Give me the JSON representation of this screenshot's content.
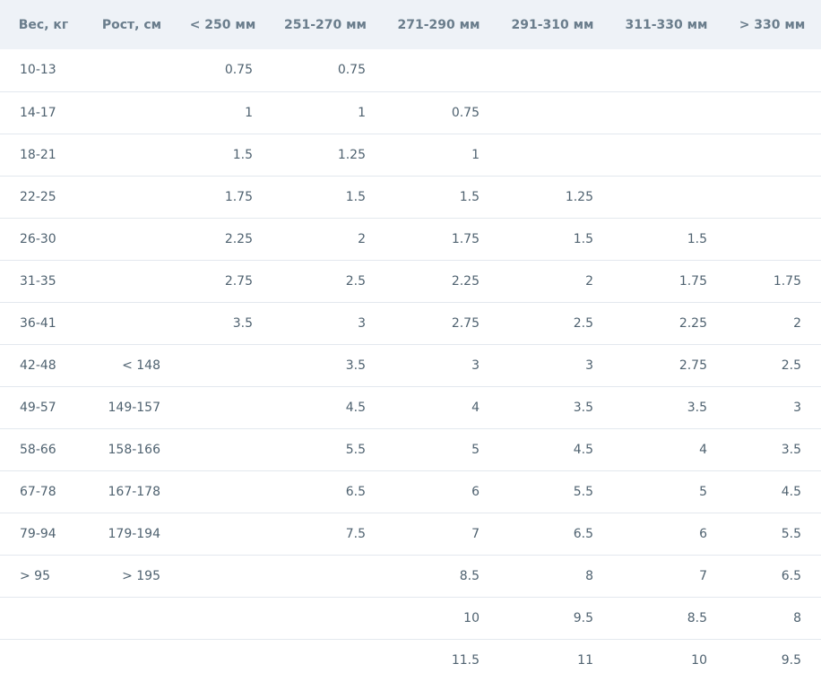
{
  "table": {
    "headers": [
      "Вес, кг",
      "Рост, см",
      "< 250 мм",
      "251-270 мм",
      "271-290 мм",
      "291-310 мм",
      "311-330 мм",
      "> 330 мм"
    ],
    "rows": [
      [
        "10-13",
        "",
        "0.75",
        "0.75",
        "",
        "",
        "",
        ""
      ],
      [
        "14-17",
        "",
        "1",
        "1",
        "0.75",
        "",
        "",
        ""
      ],
      [
        "18-21",
        "",
        "1.5",
        "1.25",
        "1",
        "",
        "",
        ""
      ],
      [
        "22-25",
        "",
        "1.75",
        "1.5",
        "1.5",
        "1.25",
        "",
        ""
      ],
      [
        "26-30",
        "",
        "2.25",
        "2",
        "1.75",
        "1.5",
        "1.5",
        ""
      ],
      [
        "31-35",
        "",
        "2.75",
        "2.5",
        "2.25",
        "2",
        "1.75",
        "1.75"
      ],
      [
        "36-41",
        "",
        "3.5",
        "3",
        "2.75",
        "2.5",
        "2.25",
        "2"
      ],
      [
        "42-48",
        "< 148",
        "",
        "3.5",
        "3",
        "3",
        "2.75",
        "2.5"
      ],
      [
        "49-57",
        "149-157",
        "",
        "4.5",
        "4",
        "3.5",
        "3.5",
        "3"
      ],
      [
        "58-66",
        "158-166",
        "",
        "5.5",
        "5",
        "4.5",
        "4",
        "3.5"
      ],
      [
        "67-78",
        "167-178",
        "",
        "6.5",
        "6",
        "5.5",
        "5",
        "4.5"
      ],
      [
        "79-94",
        "179-194",
        "",
        "7.5",
        "7",
        "6.5",
        "6",
        "5.5"
      ],
      [
        "> 95",
        "> 195",
        "",
        "",
        "8.5",
        "8",
        "7",
        "6.5"
      ],
      [
        "",
        "",
        "",
        "",
        "10",
        "9.5",
        "8.5",
        "8"
      ],
      [
        "",
        "",
        "",
        "",
        "11.5",
        "11",
        "10",
        "9.5"
      ]
    ]
  }
}
